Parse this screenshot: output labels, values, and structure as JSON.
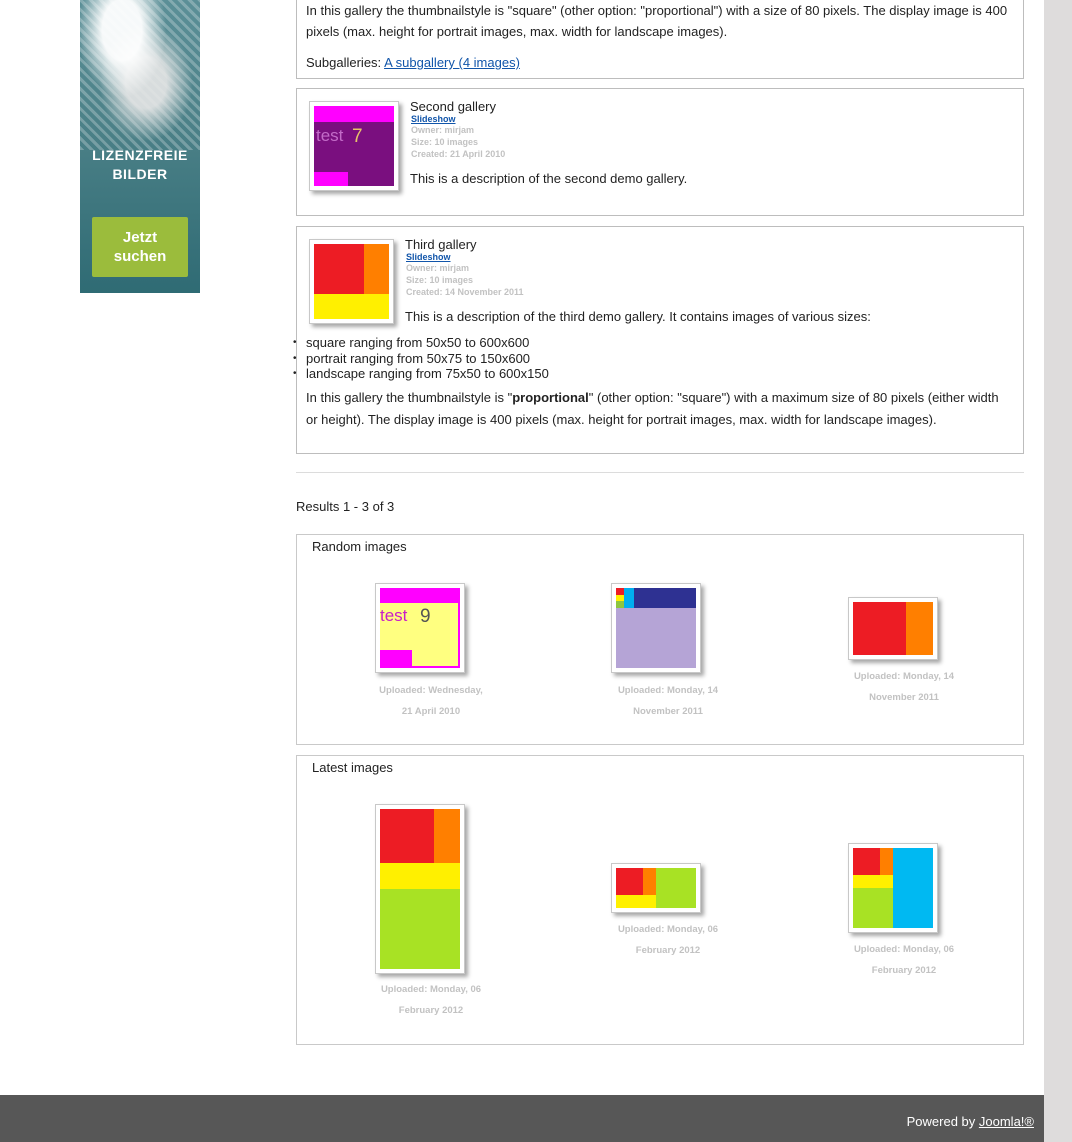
{
  "ad": {
    "title_line1": "LIZENZFREIE",
    "title_line2": "BILDER",
    "button_line1": "Jetzt",
    "button_line2": "suchen"
  },
  "first_gallery": {
    "description": "In this gallery the thumbnailstyle is \"square\" (other option: \"proportional\") with a size of 80 pixels. The display image is 400 pixels (max. height for portrait images, max. width for landscape images).",
    "subgalleries_label": "Subgalleries:",
    "subgallery_link": "A subgallery (4 images)"
  },
  "second_gallery": {
    "title": "Second gallery",
    "slideshow": "Slideshow",
    "owner": "Owner: mirjam",
    "size": "Size: 10 images",
    "created": "Created: 21 April 2010",
    "description": "This is a description of the second demo gallery.",
    "thumb_text_a": "test",
    "thumb_text_b": "7"
  },
  "third_gallery": {
    "title": "Third gallery",
    "slideshow": "Slideshow",
    "owner": "Owner: mirjam",
    "size": "Size: 10 images",
    "created": "Created: 14 November 2011",
    "description": "This is a description of the third demo gallery. It contains images of various sizes:",
    "list": [
      "square ranging from 50x50 to 600x600",
      "portrait ranging from 50x75 to 150x600",
      "landscape ranging from 75x50 to 600x150"
    ],
    "para_prefix": "In this gallery the thumbnailstyle is \"",
    "para_bold": "proportional",
    "para_suffix": "\" (other option: \"square\") with a maximum size of 80 pixels (either width or height). The display image is 400 pixels (max. height for portrait images, max. width for landscape images)."
  },
  "results": "Results 1 - 3 of 3",
  "random_images": {
    "title": "Random images",
    "items": [
      {
        "caption_line1": "Uploaded: Wednesday,",
        "caption_line2": "21 April 2010",
        "thumb_text_a": "test",
        "thumb_text_b": "9"
      },
      {
        "caption_line1": "Uploaded: Monday, 14",
        "caption_line2": "November 2011"
      },
      {
        "caption_line1": "Uploaded: Monday, 14",
        "caption_line2": "November 2011"
      }
    ]
  },
  "latest_images": {
    "title": "Latest images",
    "items": [
      {
        "caption_line1": "Uploaded: Monday, 06",
        "caption_line2": "February 2012"
      },
      {
        "caption_line1": "Uploaded: Monday, 06",
        "caption_line2": "February 2012"
      },
      {
        "caption_line1": "Uploaded: Monday, 06",
        "caption_line2": "February 2012"
      }
    ]
  },
  "footer": {
    "powered_by": "Powered by",
    "joomla_link": "Joomla!®"
  },
  "colors": {
    "link": "#1155aa",
    "meta_gray": "#c2c2c2",
    "footer_bg": "#575757",
    "ad_button": "#9bbc3c"
  }
}
